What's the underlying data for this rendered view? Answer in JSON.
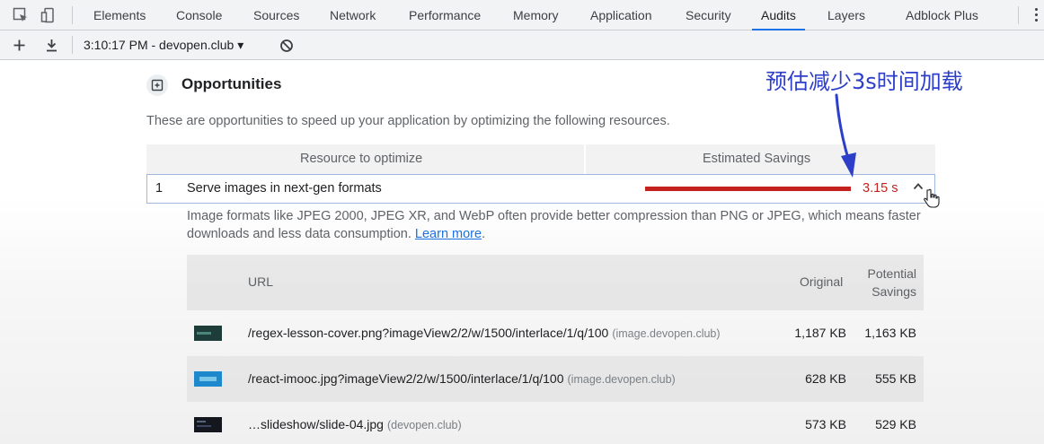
{
  "devtools": {
    "tabs": [
      "Elements",
      "Console",
      "Sources",
      "Network",
      "Performance",
      "Memory",
      "Application",
      "Security",
      "Audits",
      "Layers",
      "Adblock Plus"
    ],
    "active_tab": "Audits",
    "report_selector": "3:10:17 PM - devopen.club ▾"
  },
  "section": {
    "title": "Opportunities",
    "description": "These are opportunities to speed up your application by optimizing the following resources."
  },
  "table_header": {
    "resource": "Resource to optimize",
    "savings": "Estimated Savings"
  },
  "opportunity": {
    "index": "1",
    "title": "Serve images in next-gen formats",
    "savings": "3.15 s",
    "savings_fraction": 1.0,
    "detail_text": "Image formats like JPEG 2000, JPEG XR, and WebP often provide better compression than PNG or JPEG, which means faster downloads and less data consumption.",
    "learn_more": "Learn more",
    "period": "."
  },
  "details_table": {
    "headers": {
      "url": "URL",
      "original": "Original",
      "potential_line1": "Potential",
      "potential_line2": "Savings"
    },
    "rows": [
      {
        "url": "/regex-lesson-cover.png?imageView2/2/w/1500/interlace/1/q/100",
        "host": "(image.devopen.club)",
        "original": "1,187 KB",
        "savings": "1,163 KB"
      },
      {
        "url": "/react-imooc.jpg?imageView2/2/w/1500/interlace/1/q/100",
        "host": "(image.devopen.club)",
        "original": "628 KB",
        "savings": "555 KB"
      },
      {
        "url": "…slideshow/slide-04.jpg",
        "host": "(devopen.club)",
        "original": "573 KB",
        "savings": "529 KB"
      }
    ]
  },
  "annotation": {
    "text": "预估减少3s时间加载",
    "color": "#2d3ec9"
  },
  "colors": {
    "accent": "#1a73e8",
    "fail_red": "#c5221f"
  }
}
